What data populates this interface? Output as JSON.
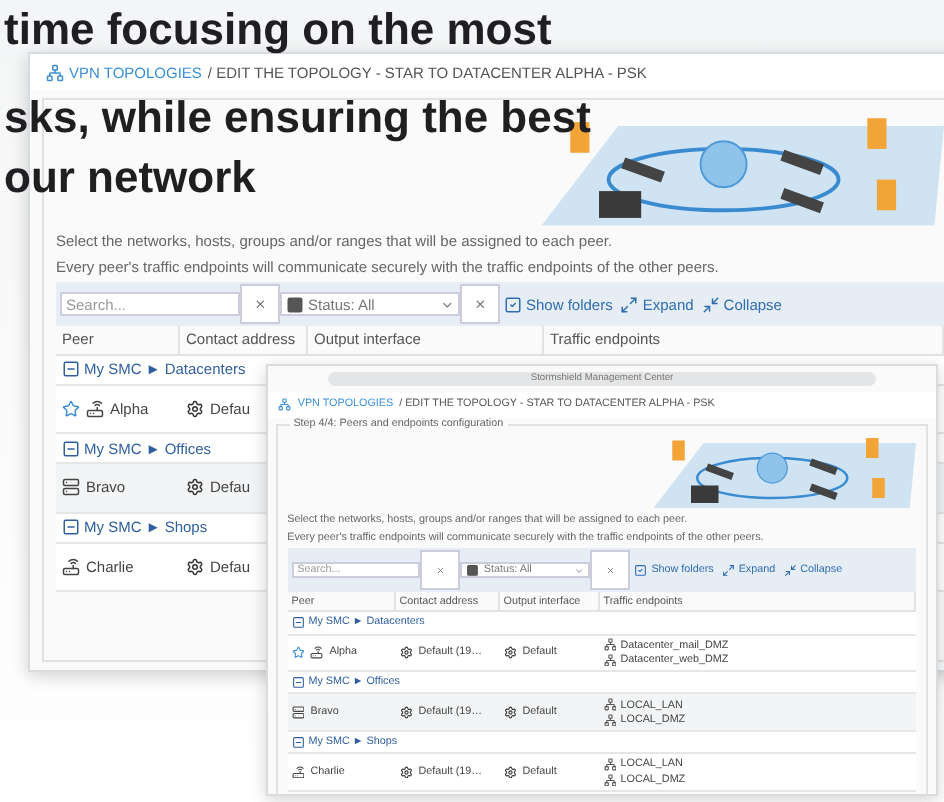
{
  "headline": [
    "time focusing on the most",
    "sks, while ensuring the best",
    "our network"
  ],
  "back_window": {
    "breadcrumb_root": "VPN TOPOLOGIES",
    "breadcrumb_path": "/ EDIT THE TOPOLOGY - STAR TO DATACENTER ALPHA - PSK",
    "description": [
      "Select the networks, hosts, groups and/or ranges that will be assigned to each peer.",
      "Every peer's traffic endpoints will communicate securely with the traffic endpoints of the other peers."
    ],
    "toolbar": {
      "search_placeholder": "Search...",
      "status": "Status: All",
      "show_folders": "Show folders",
      "show_folders_checked": true,
      "expand": "Expand",
      "collapse": "Collapse"
    },
    "columns": [
      "Peer",
      "Contact address",
      "Output interface",
      "Traffic endpoints"
    ],
    "groups": [
      {
        "label": "My SMC ► Datacenters",
        "peers": [
          {
            "name": "Alpha",
            "kind": "router",
            "favorite": true,
            "contact": "Defau"
          }
        ]
      },
      {
        "label": "My SMC ► Offices",
        "peers": [
          {
            "name": "Bravo",
            "kind": "cluster",
            "favorite": false,
            "contact": "Defau"
          }
        ]
      },
      {
        "label": "My SMC ► Shops",
        "peers": [
          {
            "name": "Charlie",
            "kind": "router",
            "favorite": false,
            "contact": "Defau"
          }
        ]
      }
    ]
  },
  "front_window": {
    "title_bar": "Stormshield Management Center",
    "breadcrumb_root": "VPN TOPOLOGIES",
    "breadcrumb_path": "/ EDIT THE TOPOLOGY - STAR TO DATACENTER ALPHA - PSK",
    "step": "Step 4/4: Peers and endpoints configuration",
    "description": [
      "Select the networks, hosts, groups and/or ranges that will be assigned to each peer.",
      "Every peer's traffic endpoints will communicate securely with the traffic endpoints of the other peers."
    ],
    "toolbar": {
      "search_placeholder": "Search...",
      "status": "Status: All",
      "show_folders": "Show folders",
      "show_folders_checked": true,
      "expand": "Expand",
      "collapse": "Collapse"
    },
    "columns": [
      "Peer",
      "Contact address",
      "Output interface",
      "Traffic endpoints"
    ],
    "groups": [
      {
        "label": "My SMC ► Datacenters",
        "peers": [
          {
            "name": "Alpha",
            "kind": "router",
            "favorite": true,
            "contact": "Default (19…",
            "output": "Default",
            "endpoints": [
              "Datacenter_mail_DMZ",
              "Datacenter_web_DMZ"
            ]
          }
        ]
      },
      {
        "label": "My SMC ► Offices",
        "peers": [
          {
            "name": "Bravo",
            "kind": "cluster",
            "favorite": false,
            "contact": "Default (19…",
            "output": "Default",
            "endpoints": [
              "LOCAL_LAN",
              "LOCAL_DMZ"
            ]
          }
        ]
      },
      {
        "label": "My SMC ► Shops",
        "peers": [
          {
            "name": "Charlie",
            "kind": "router",
            "favorite": false,
            "contact": "Default (19…",
            "output": "Default",
            "endpoints": [
              "LOCAL_LAN",
              "LOCAL_DMZ"
            ]
          }
        ]
      }
    ]
  }
}
